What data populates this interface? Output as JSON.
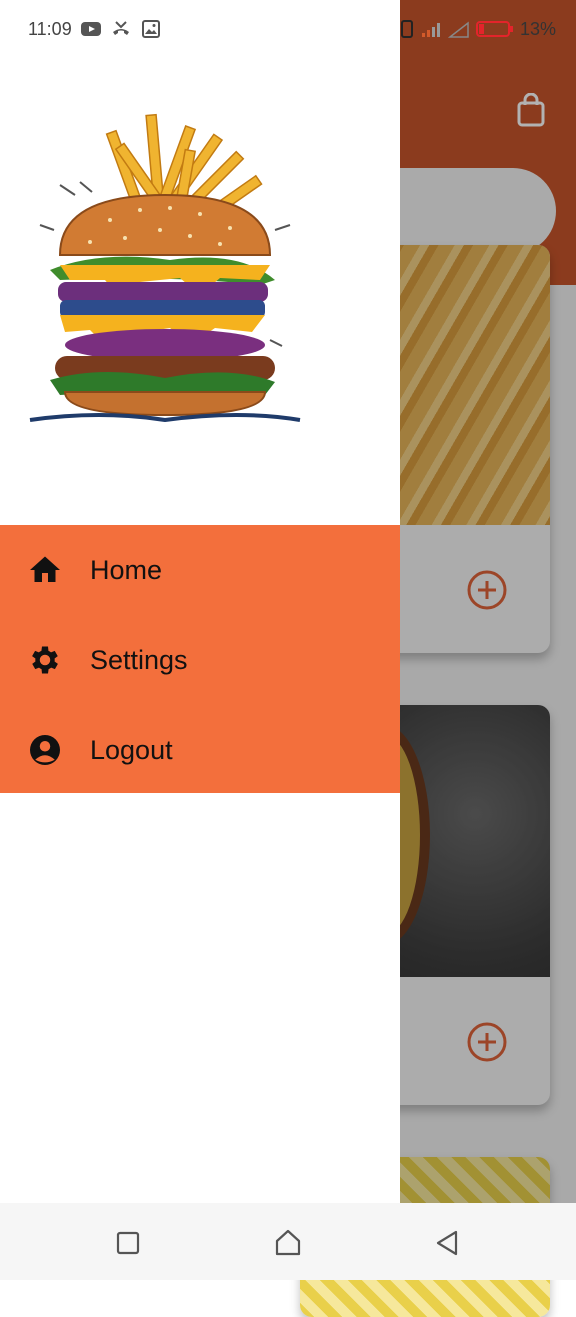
{
  "status_bar": {
    "time": "11:09",
    "battery": "13%",
    "left_icons": [
      "youtube-icon",
      "missed-call-icon",
      "image-icon"
    ],
    "right_icons": [
      "vibrate-icon",
      "signal-icon",
      "signal-empty-icon",
      "battery-low-icon"
    ]
  },
  "drawer": {
    "logo": "burger-fries-logo",
    "menu": [
      {
        "label": "Home",
        "icon": "home-icon"
      },
      {
        "label": "Settings",
        "icon": "gear-icon"
      },
      {
        "label": "Logout",
        "icon": "account-circle-icon"
      }
    ]
  },
  "colors": {
    "drawer_menu_bg": "#f36f3c",
    "header_bg": "#c8552b",
    "accent": "#e0643a"
  },
  "navigation_bar": {
    "buttons": [
      "recents-button",
      "home-button",
      "back-button"
    ]
  }
}
